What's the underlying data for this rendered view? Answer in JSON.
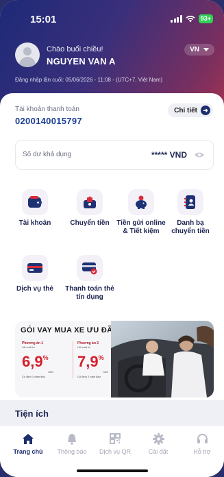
{
  "status_bar": {
    "time": "15:01",
    "battery": "93+"
  },
  "header": {
    "greeting": "Chào buổi chiều!",
    "user_name": "NGUYEN VAN A",
    "language": "VN",
    "last_login": "Đăng nhập lần cuối: 05/06/2026 - 11:08 - (UTC+7, Việt Nam)"
  },
  "account": {
    "label": "Tài khoản thanh toán",
    "number": "0200140015797",
    "detail_label": "Chi tiết",
    "balance_label": "Số dư khả dụng",
    "balance_value": "***** VND"
  },
  "menu": [
    {
      "label": "Tài khoản",
      "icon": "wallet-icon"
    },
    {
      "label": "Chuyển tiền",
      "icon": "money-transfer-icon"
    },
    {
      "label": "Tiền gửi online & Tiết kiệm",
      "icon": "piggy-bank-icon"
    },
    {
      "label": "Danh bạ chuyển tiền",
      "icon": "contacts-icon"
    },
    {
      "label": "Dịch vụ thẻ",
      "icon": "card-icon"
    },
    {
      "label": "Thanh toán thẻ tín dụng",
      "icon": "credit-card-payment-icon"
    }
  ],
  "banner": {
    "title": "GÓI VAY MUA XE ƯU ĐÃI",
    "plans": [
      {
        "name": "Phương án 1",
        "sub": "Lãi suất từ",
        "rate": "6,9",
        "unit": "%",
        "per": "năm",
        "note": "Cố định 1 năm đầu"
      },
      {
        "name": "Phương án 2",
        "sub": "Lãi suất từ",
        "rate": "7,9",
        "unit": "%",
        "per": "năm",
        "note": "Cố định 2 năm đầu"
      }
    ]
  },
  "utilities": {
    "title": "Tiện ích"
  },
  "bottom_nav": [
    {
      "label": "Trang chủ",
      "icon": "home-icon",
      "active": true
    },
    {
      "label": "Thông báo",
      "icon": "bell-icon",
      "active": false
    },
    {
      "label": "Dịch vụ QR",
      "icon": "qr-code-icon",
      "active": false
    },
    {
      "label": "Cài đặt",
      "icon": "gear-icon",
      "active": false
    },
    {
      "label": "Hỗ trợ",
      "icon": "headset-icon",
      "active": false
    }
  ],
  "colors": {
    "brand_navy": "#1c2e6e",
    "accent_red": "#d71f2c",
    "account_blue": "#1c3f94"
  }
}
